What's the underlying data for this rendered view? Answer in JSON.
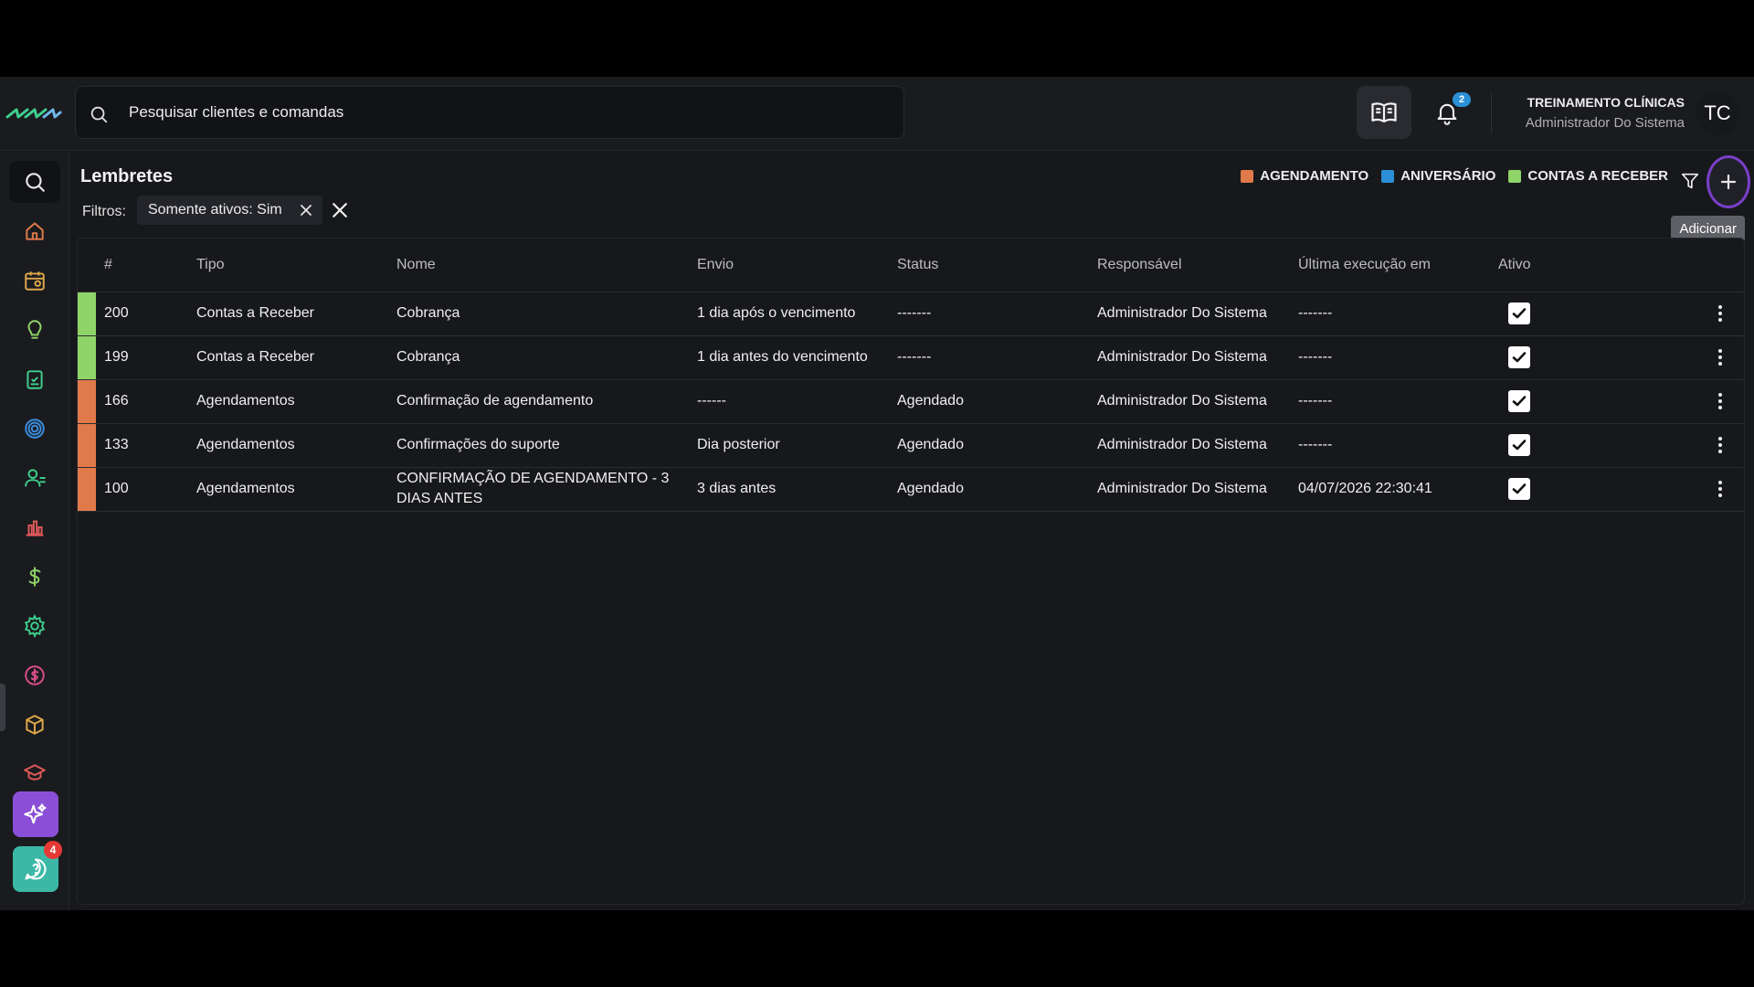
{
  "search": {
    "placeholder": "Pesquisar clientes e comandas"
  },
  "notifications": {
    "count": "2"
  },
  "user": {
    "name": "TREINAMENTO CLÍNICAS",
    "role": "Administrador Do Sistema",
    "initials": "TC",
    "avatar_color": "#17181b"
  },
  "chat": {
    "badge": "4"
  },
  "page": {
    "title": "Lembretes",
    "filters_label": "Filtros:",
    "filter_chip": "Somente ativos: Sim",
    "add_tooltip": "Adicionar"
  },
  "legend": [
    {
      "label": "AGENDAMENTO",
      "color": "#e07a4a"
    },
    {
      "label": "ANIVERSÁRIO",
      "color": "#2a8fd6"
    },
    {
      "label": "CONTAS A RECEBER",
      "color": "#8fd468"
    }
  ],
  "table": {
    "headers": {
      "id": "#",
      "tipo": "Tipo",
      "nome": "Nome",
      "envio": "Envio",
      "status": "Status",
      "responsavel": "Responsável",
      "ultima": "Última execução em",
      "ativo": "Ativo"
    },
    "rows": [
      {
        "color": "#8fd468",
        "id": "200",
        "tipo": "Contas a Receber",
        "nome": "Cobrança",
        "envio": "1 dia após o vencimento",
        "status": "-------",
        "responsavel": "Administrador Do Sistema",
        "ultima": "-------",
        "ativo": true
      },
      {
        "color": "#8fd468",
        "id": "199",
        "tipo": "Contas a Receber",
        "nome": "Cobrança",
        "envio": "1 dia antes do vencimento",
        "status": "-------",
        "responsavel": "Administrador Do Sistema",
        "ultima": "-------",
        "ativo": true
      },
      {
        "color": "#e07a4a",
        "id": "166",
        "tipo": "Agendamentos",
        "nome": "Confirmação de agendamento",
        "envio": "------",
        "status": "Agendado",
        "responsavel": "Administrador Do Sistema",
        "ultima": "-------",
        "ativo": true
      },
      {
        "color": "#e07a4a",
        "id": "133",
        "tipo": "Agendamentos",
        "nome": "Confirmações do suporte",
        "envio": "Dia posterior",
        "status": "Agendado",
        "responsavel": "Administrador Do Sistema",
        "ultima": "-------",
        "ativo": true
      },
      {
        "color": "#e07a4a",
        "id": "100",
        "tipo": "Agendamentos",
        "nome": "CONFIRMAÇÃO DE AGENDAMENTO - 3 DIAS ANTES",
        "envio": "3 dias antes",
        "status": "Agendado",
        "responsavel": "Administrador Do Sistema",
        "ultima": "04/07/2026 22:30:41",
        "ativo": true
      }
    ]
  },
  "sidebar": {
    "icons": [
      "search-icon",
      "home-icon",
      "calendar-icon",
      "lightbulb-icon",
      "clipboard-check-icon",
      "target-icon",
      "user-group-icon",
      "bar-chart-icon",
      "dollar-icon",
      "gear-icon",
      "coin-icon",
      "box-icon",
      "graduation-cap-icon"
    ],
    "active": "gear-icon"
  },
  "colors": {
    "accent_green": "#3ecf8e",
    "accent_purple": "#8a4fd6",
    "chat_teal": "#3bb8a6"
  }
}
